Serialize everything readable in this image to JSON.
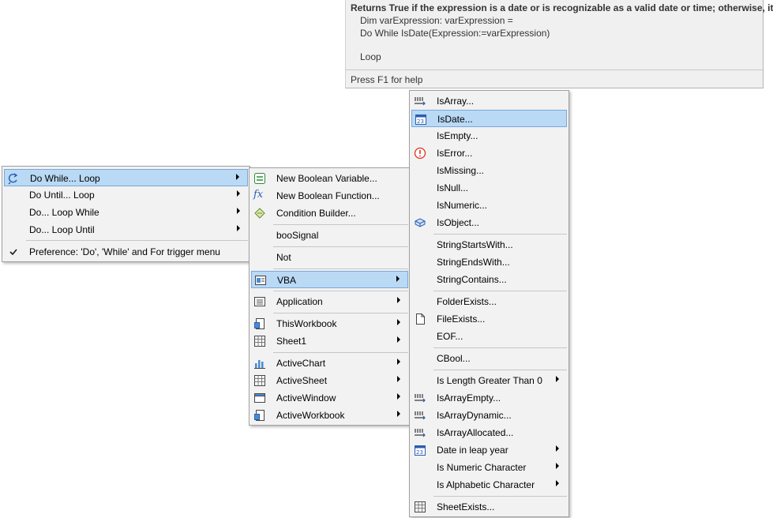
{
  "tooltip": {
    "title": "Returns True if the expression is a date or is recognizable as a valid date or time; otherwise, it",
    "line1": "Dim varExpression: varExpression =",
    "line2": "Do While IsDate(Expression:=varExpression)",
    "line3": "Loop",
    "help": "Press F1 for help"
  },
  "menu1": {
    "items": [
      {
        "label": "Do While... Loop",
        "icon": "loop-icon",
        "submenu": true,
        "highlighted": true
      },
      {
        "label": "Do Until... Loop",
        "submenu": true
      },
      {
        "label": "Do... Loop While",
        "submenu": true
      },
      {
        "label": "Do... Loop Until",
        "submenu": true
      },
      {
        "label": "Preference: 'Do', 'While' and For trigger menu",
        "icon": "checkmark-icon",
        "checked": true
      }
    ]
  },
  "menu2": {
    "items": [
      {
        "label": "New Boolean Variable...",
        "icon": "boolean-variable-icon"
      },
      {
        "label": "New Boolean Function...",
        "icon": "function-fx-icon"
      },
      {
        "label": "Condition Builder...",
        "icon": "condition-builder-icon"
      },
      {
        "label": "booSignal"
      },
      {
        "label": "Not"
      },
      {
        "label": "VBA",
        "icon": "vba-icon",
        "submenu": true,
        "highlighted": true
      },
      {
        "label": "Application",
        "icon": "application-icon",
        "submenu": true
      },
      {
        "label": "ThisWorkbook",
        "icon": "workbook-icon",
        "submenu": true
      },
      {
        "label": "Sheet1",
        "icon": "sheet-icon",
        "submenu": true
      },
      {
        "label": "ActiveChart",
        "icon": "chart-icon",
        "submenu": true
      },
      {
        "label": "ActiveSheet",
        "icon": "sheet-icon",
        "submenu": true
      },
      {
        "label": "ActiveWindow",
        "icon": "window-icon",
        "submenu": true
      },
      {
        "label": "ActiveWorkbook",
        "icon": "workbook-icon",
        "submenu": true
      }
    ]
  },
  "menu3": {
    "items": [
      {
        "label": "IsArray...",
        "icon": "array-icon"
      },
      {
        "label": "IsDate...",
        "icon": "calendar-icon",
        "highlighted": true
      },
      {
        "label": "IsEmpty..."
      },
      {
        "label": "IsError...",
        "icon": "error-icon"
      },
      {
        "label": "IsMissing..."
      },
      {
        "label": "IsNull..."
      },
      {
        "label": "IsNumeric..."
      },
      {
        "label": "IsObject...",
        "icon": "object-icon"
      },
      {
        "label": "StringStartsWith..."
      },
      {
        "label": "StringEndsWith..."
      },
      {
        "label": "StringContains..."
      },
      {
        "label": "FolderExists..."
      },
      {
        "label": "FileExists...",
        "icon": "file-icon"
      },
      {
        "label": "EOF..."
      },
      {
        "label": "CBool..."
      },
      {
        "label": "Is Length Greater Than 0",
        "submenu": true
      },
      {
        "label": "IsArrayEmpty...",
        "icon": "array-icon"
      },
      {
        "label": "IsArrayDynamic...",
        "icon": "array-icon"
      },
      {
        "label": "IsArrayAllocated...",
        "icon": "array-icon"
      },
      {
        "label": "Date in leap year",
        "icon": "calendar-icon",
        "submenu": true
      },
      {
        "label": "Is Numeric Character",
        "submenu": true
      },
      {
        "label": "Is Alphabetic Character",
        "submenu": true
      },
      {
        "label": "SheetExists...",
        "icon": "sheet-icon"
      }
    ]
  },
  "colors": {
    "highlight": "#b9d9f5",
    "highlight_border": "#7aa8d8",
    "menu_bg": "#f2f2f2",
    "tooltip_bg": "#f0f0f0",
    "error_red": "#e0301e"
  }
}
